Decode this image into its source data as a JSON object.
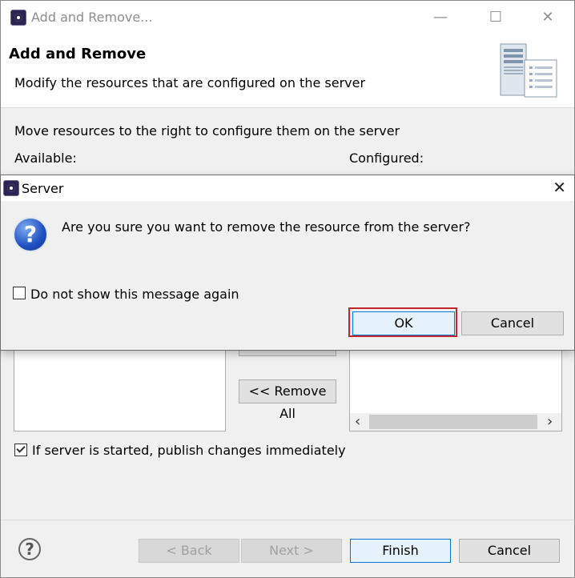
{
  "window": {
    "title": "Add and Remove...",
    "controls": {
      "minimize": "—",
      "maximize": "☐",
      "close": "✕"
    }
  },
  "header": {
    "title": "Add and Remove",
    "subtitle": "Modify the resources that are configured on the server"
  },
  "main": {
    "instruction": "Move resources to the right to configure them on the server",
    "available_label": "Available:",
    "configured_label": "Configured:",
    "remove_all_label": "<< Remove All",
    "scroll_left": "‹",
    "scroll_right": "›",
    "publish_checkbox_label": "If server is started, publish changes immediately",
    "publish_checked": true
  },
  "footer": {
    "help": "?",
    "back_label": "< Back",
    "next_label": "Next >",
    "finish_label": "Finish",
    "cancel_label": "Cancel"
  },
  "dialog": {
    "title": "Server",
    "close": "✕",
    "question_mark": "?",
    "message": "Are you sure you want to remove the resource from the server?",
    "checkbox_label": "Do not show this message again",
    "checkbox_checked": false,
    "ok_label": "OK",
    "cancel_label": "Cancel"
  },
  "colors": {
    "focus_highlight": "#c1272d",
    "primary_border": "#0078d7"
  }
}
